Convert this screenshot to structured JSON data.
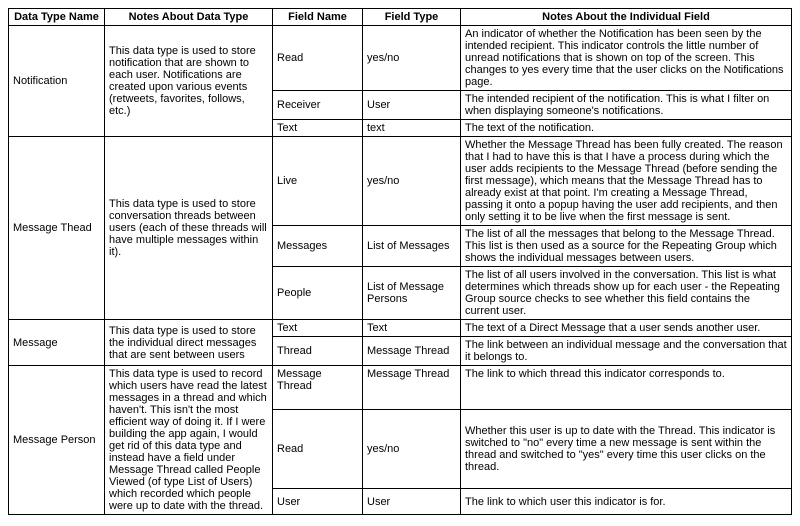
{
  "headers": {
    "dtname": "Data Type Name",
    "dtnotes": "Notes About Data Type",
    "fname": "Field Name",
    "ftype": "Field Type",
    "fnotes": "Notes About the Individual Field"
  },
  "rows": {
    "notification": {
      "name": "Notification",
      "notes": "This data type is used to store notification that are shown to each user. Notifications are created upon various events (retweets, favorites, follows, etc.)",
      "fields": {
        "read": {
          "name": "Read",
          "type": "yes/no",
          "notes": "An indicator of whether the Notification has been seen by the intended recipient. This indicator controls the little number of unread notifications that is shown on top of the screen. This changes to yes every time that the user clicks on the Notifications page."
        },
        "receiver": {
          "name": "Receiver",
          "type": "User",
          "notes": "The intended recipient of the notification. This is what I filter on when displaying someone's notifications."
        },
        "text": {
          "name": "Text",
          "type": "text",
          "notes": "The text of the notification."
        }
      }
    },
    "mthread": {
      "name": "Message Thead",
      "notes": "This data type is used to store conversation threads between users (each of these threads will have multiple messages within it).",
      "fields": {
        "live": {
          "name": "Live",
          "type": "yes/no",
          "notes": "Whether the Message Thread has been fully created. The reason that I had to have this is that I have a process during which the user adds recipients to the Message Thread (before sending the first message), which means that the Message Thread has to already exist at that point.  I'm creating a Message Thread, passing it onto a popup having the user add recipients, and then only setting it to be live when the first message is sent."
        },
        "messages": {
          "name": "Messages",
          "type": "List of Messages",
          "notes": "The list of all the messages that belong to the Message Thread. This list is then used as a source for the Repeating Group which shows the individual messages between users."
        },
        "people": {
          "name": "People",
          "type": "List of Message Persons",
          "notes": "The list of all users involved in the conversation. This list is what determines which threads show up for each user - the Repeating Group source checks to see whether this field contains the current user."
        }
      }
    },
    "message": {
      "name": "Message",
      "notes": "This data type is used to store the individual direct messages that are sent between users",
      "fields": {
        "text": {
          "name": "Text",
          "type": "Text",
          "notes": "The text of a Direct Message that a user sends another user."
        },
        "thread": {
          "name": "Thread",
          "type": "Message Thread",
          "notes": "The link between an individual message and the conversation that it belongs to."
        }
      }
    },
    "mperson": {
      "name": "Message Person",
      "notes": "This data type is used to record which users have read the latest messages in a thread and which haven't. This isn't the most efficient way of doing it. If I were building the app again, I would get rid of this data type and instead have a field under Message Thread called People Viewed (of type List of Users) which recorded which people were up to date with the thread.",
      "fields": {
        "mthread": {
          "name": "Message Thread",
          "type": "Message Thread",
          "notes": "The link to which thread this indicator corresponds to."
        },
        "read": {
          "name": "Read",
          "type": "yes/no",
          "notes": "Whether this user is up to date with the Thread. This indicator is switched to \"no\" every time a new message is sent within the thread and switched to \"yes\" every time this user clicks on the thread."
        },
        "user": {
          "name": "User",
          "type": "User",
          "notes": "The link to which user this indicator is for."
        }
      }
    }
  }
}
